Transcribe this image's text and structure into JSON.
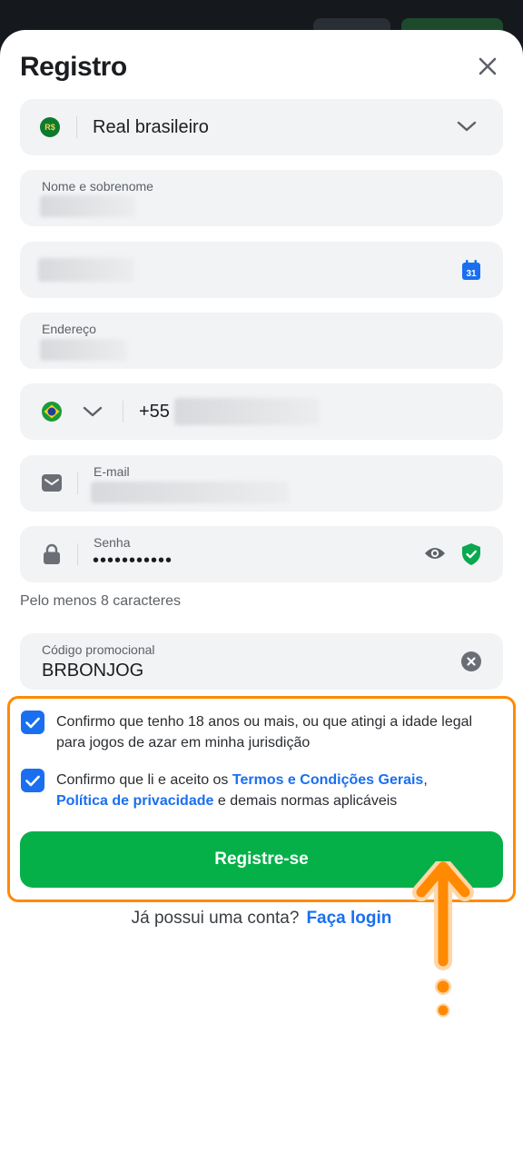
{
  "title": "Registro",
  "currency": {
    "badge": "R$",
    "value": "Real brasileiro"
  },
  "name_field": {
    "label": "Nome e sobrenome"
  },
  "date_field": {
    "calendar_day": "31"
  },
  "address_field": {
    "label": "Endereço"
  },
  "phone_field": {
    "prefix": "+55"
  },
  "email_field": {
    "label": "E-mail"
  },
  "password_field": {
    "label": "Senha",
    "masked_value": "•••••••••••"
  },
  "password_hint": "Pelo menos 8 caracteres",
  "promo_field": {
    "label": "Código promocional",
    "value": "BRBONJOG"
  },
  "consent_age": "Confirmo que tenho 18 anos ou mais, ou que atingi a idade legal para jogos de azar em minha jurisdição",
  "consent_terms": {
    "prefix": "Confirmo que li e aceito os ",
    "terms_link": "Termos e Condições Gerais",
    "comma": ",",
    "privacy_link": "Política de privacidade",
    "suffix": " e demais normas aplicáveis"
  },
  "register_button": "Registre-se",
  "login_prompt": {
    "text": "Já possui uma conta?",
    "link": "Faça login"
  },
  "colors": {
    "accent": "#1a6ff0",
    "primary_button": "#06b049",
    "highlight": "#ff8a00",
    "shield": "#0aa84f"
  }
}
